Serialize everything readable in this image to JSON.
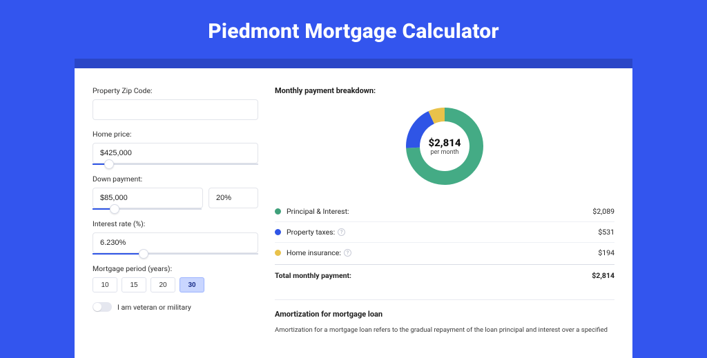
{
  "title": "Piedmont Mortgage Calculator",
  "form": {
    "zip_label": "Property Zip Code:",
    "zip_value": "",
    "home_price_label": "Home price:",
    "home_price_value": "$425,000",
    "home_price_slider_pct": 10,
    "down_payment_label": "Down payment:",
    "down_payment_value": "$85,000",
    "down_payment_pct": "20%",
    "down_payment_slider_pct": 20,
    "interest_label": "Interest rate (%):",
    "interest_value": "6.230%",
    "interest_slider_pct": 31,
    "period_label": "Mortgage period (years):",
    "periods": [
      "10",
      "15",
      "20",
      "30"
    ],
    "period_active_index": 3,
    "veteran_label": "I am veteran or military"
  },
  "breakdown": {
    "title": "Monthly payment breakdown:",
    "center_amount": "$2,814",
    "center_sub": "per month",
    "items": [
      {
        "color": "green",
        "label": "Principal & Interest:",
        "value": "$2,089",
        "info": false
      },
      {
        "color": "blue",
        "label": "Property taxes:",
        "value": "$531",
        "info": true
      },
      {
        "color": "yellow",
        "label": "Home insurance:",
        "value": "$194",
        "info": true
      }
    ],
    "total_label": "Total monthly payment:",
    "total_value": "$2,814"
  },
  "chart_data": {
    "type": "pie",
    "title": "Monthly payment breakdown",
    "series": [
      {
        "name": "Principal & Interest",
        "value": 2089,
        "color": "#44ab85"
      },
      {
        "name": "Property taxes",
        "value": 531,
        "color": "#2f55e6"
      },
      {
        "name": "Home insurance",
        "value": 194,
        "color": "#e9c24a"
      }
    ],
    "total": 2814
  },
  "amortization": {
    "title": "Amortization for mortgage loan",
    "text": "Amortization for a mortgage loan refers to the gradual repayment of the loan principal and interest over a specified"
  }
}
